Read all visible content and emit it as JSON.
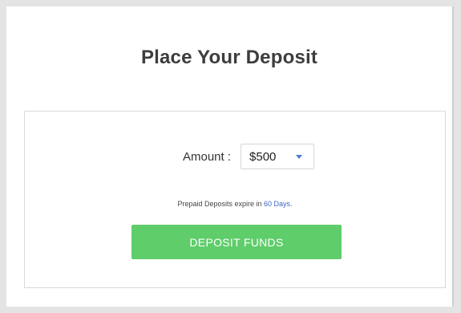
{
  "header": {
    "title": "Place Your Deposit"
  },
  "deposit_form": {
    "amount_label": "Amount :",
    "amount_value": "$500",
    "dropdown_icon": "caret-down-icon",
    "expire_text": "Prepaid Deposits expire in ",
    "expire_period": "60 Days",
    "expire_suffix": ".",
    "submit_label": "DEPOSIT FUNDS"
  },
  "colors": {
    "button": "#5ecd6a",
    "link": "#3a66c4",
    "caret": "#4a7fd1"
  }
}
